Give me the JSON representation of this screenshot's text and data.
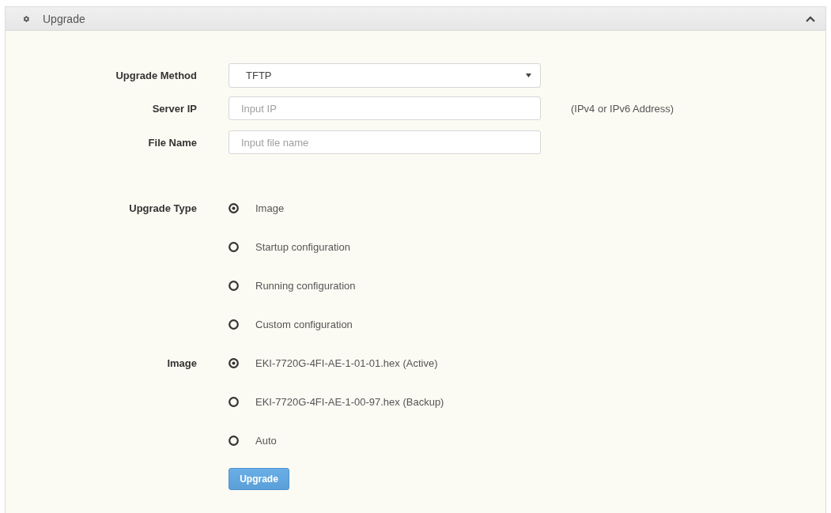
{
  "panel": {
    "title": "Upgrade",
    "expanded": true
  },
  "fields": [
    {
      "kind": "select",
      "label": "Upgrade Method",
      "value": "TFTP"
    },
    {
      "kind": "text",
      "label": "Server IP",
      "placeholder": "Input IP",
      "hint": "(IPv4 or IPv6 Address)"
    },
    {
      "kind": "text",
      "label": "File Name",
      "placeholder": "Input file name"
    },
    {
      "kind": "radio",
      "label": "Upgrade Type",
      "options": [
        {
          "label": "Image",
          "selected": true
        },
        {
          "label": "Startup configuration",
          "selected": false
        },
        {
          "label": "Running configuration",
          "selected": false
        },
        {
          "label": "Custom configuration",
          "selected": false
        }
      ]
    },
    {
      "kind": "radio",
      "label": "Image",
      "options": [
        {
          "label": "EKI-7720G-4FI-AE-1-01-01.hex (Active)",
          "selected": true
        },
        {
          "label": "EKI-7720G-4FI-AE-1-00-97.hex (Backup)",
          "selected": false
        },
        {
          "label": "Auto",
          "selected": false
        }
      ]
    }
  ],
  "submit": {
    "label": "Upgrade"
  }
}
